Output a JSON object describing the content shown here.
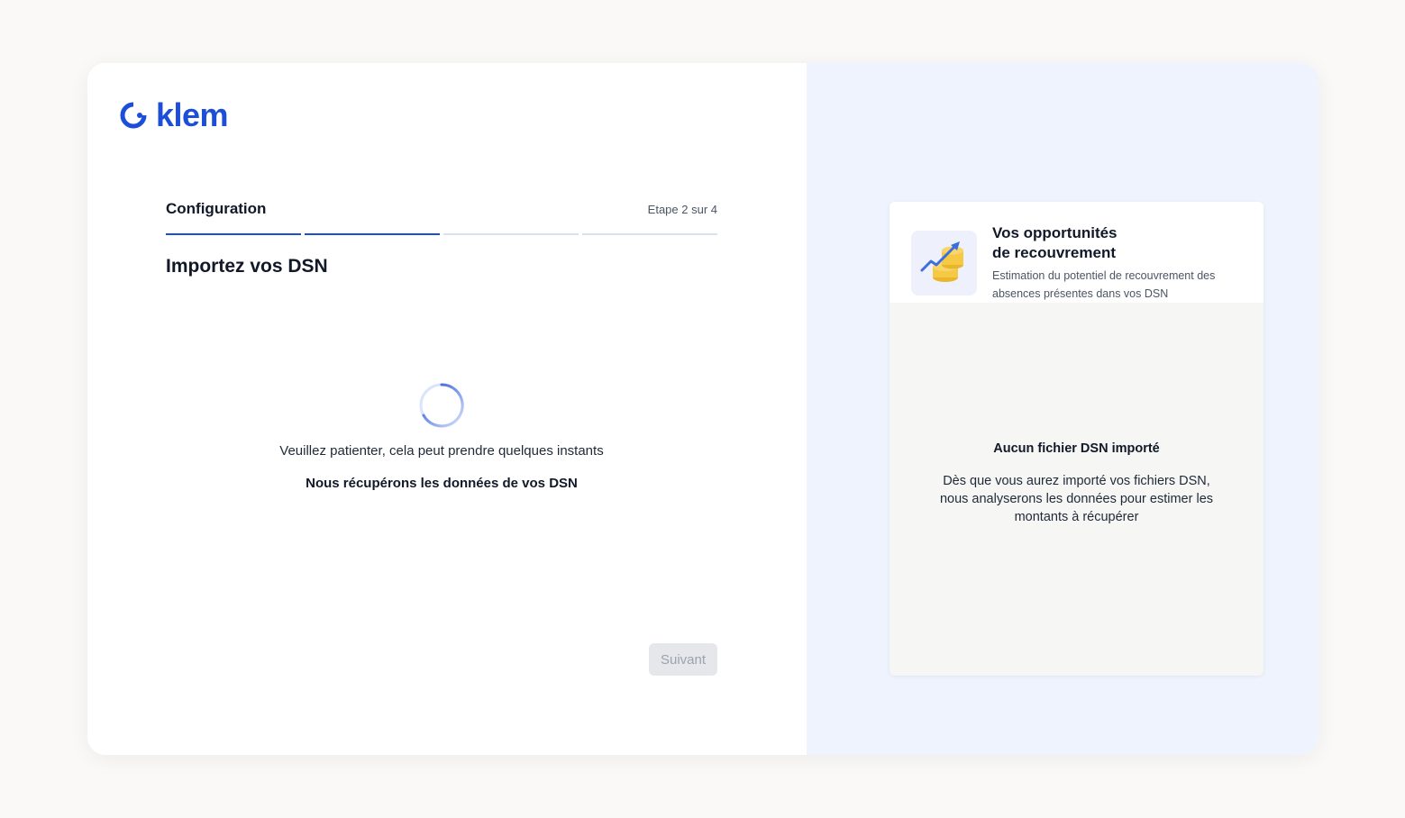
{
  "brand": {
    "name": "klem",
    "color": "#1d4ed8"
  },
  "stepper": {
    "title": "Configuration",
    "count": "Etape 2 sur 4",
    "total_steps": 4,
    "current_step": 2
  },
  "main": {
    "title": "Importez vos DSN",
    "loading_text": "Veuillez patienter, cela peut prendre quelques instants",
    "loading_sub": "Nous récupérons les données de vos DSN",
    "next_label": "Suivant"
  },
  "opportunities": {
    "title": "Vos opportunités de recouvrement",
    "description": "Estimation du potentiel de recouvrement des absences présentes dans vos DSN",
    "icon": "coins-growth-icon",
    "empty_title": "Aucun fichier DSN importé",
    "empty_desc": "Dès que vous aurez importé vos fichiers DSN, nous analyserons les données pour estimer les montants à récupérer"
  },
  "colors": {
    "accent": "#1d4ed8",
    "right_bg": "#eef3fd",
    "disabled_bg": "#e5e7eb",
    "coin": "#f6c945"
  }
}
